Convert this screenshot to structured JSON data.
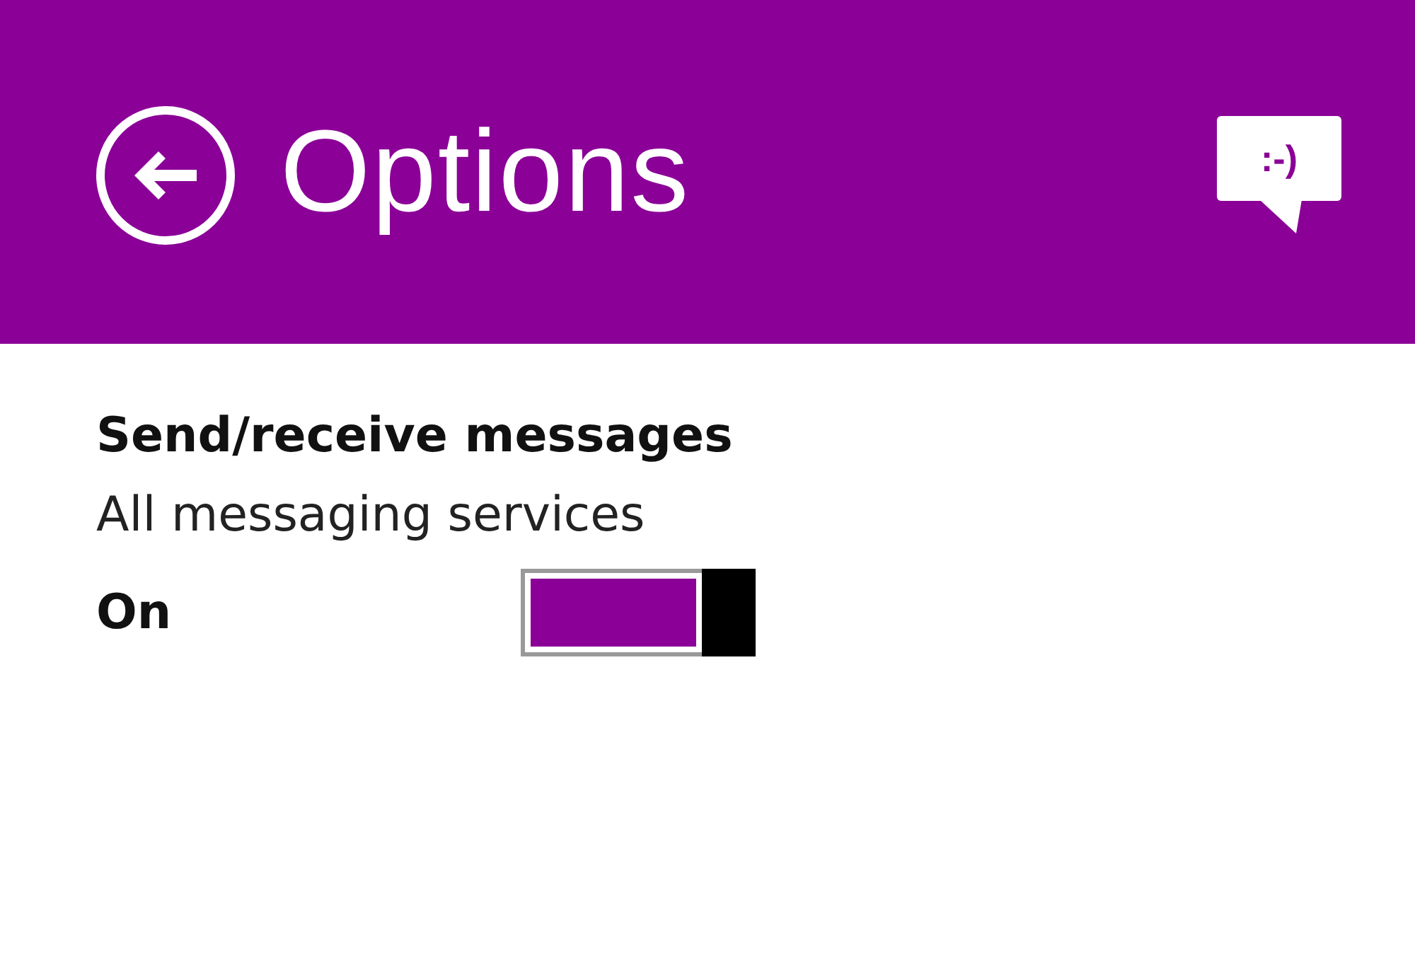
{
  "header": {
    "title": "Options",
    "feedback_icon_text": ":-)"
  },
  "setting": {
    "title": "Send/receive messages",
    "description": "All messaging services",
    "state_label": "On",
    "on": true
  }
}
